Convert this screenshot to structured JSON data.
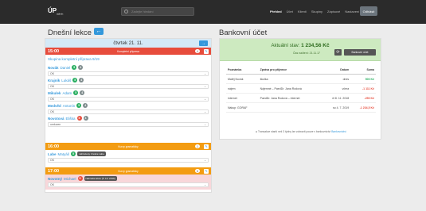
{
  "topbar": {
    "logo": "ÚP",
    "logo_sub": "admin",
    "search_placeholder": "Zadejte hledání",
    "nav": [
      "Přehled",
      "Účet",
      "Klienti",
      "Skupiny",
      "Zápisové",
      "Nastavení"
    ],
    "logout": "Odhlásit"
  },
  "left": {
    "title": "Dnešní lekce",
    "day": "čtvrtek 21. 11.",
    "lessons": [
      {
        "time": "15:00",
        "tag": "Kompletní příprava",
        "count": "4",
        "subject": "Skupina kompletní příprava 9/19",
        "students": [
          {
            "first": "Novák",
            "last": "Daniel",
            "b1": "5",
            "b2": "4",
            "select": "OK"
          },
          {
            "first": "Krajník",
            "last": "Lukáš",
            "b1": "5",
            "b2": "4",
            "select": "OK"
          },
          {
            "first": "Mikulek",
            "last": "Adam",
            "b1": "5",
            "b2": "4",
            "select": "OK"
          },
          {
            "first": "Medvěd",
            "last": "Antonín",
            "b1": "5",
            "b2": "4",
            "select": "OK"
          },
          {
            "first": "Novotová",
            "last": "Eliška",
            "b1": "5",
            "b2": "4",
            "select": "omluven"
          }
        ]
      },
      {
        "time": "16:00",
        "tag": "Kurzy gramaticky",
        "count": "1",
        "student": {
          "first": "Labe",
          "last": "Matyáš",
          "b1": "5",
          "pill": "nahrazeny 4 lekce Labe",
          "select": "OK"
        }
      },
      {
        "time": "17:00",
        "tag": "Kurzy gramaticky",
        "count": "6",
        "student": {
          "first": "Novotný",
          "last": "Michael",
          "b1": "5",
          "pill": "Náhrada lekce (5. 10. 2019)",
          "select": "OK"
        }
      }
    ]
  },
  "right": {
    "title": "Bankovní účet",
    "balance_label": "Aktuální stav:",
    "balance": "1 234,56 Kč",
    "updated": "Čas načtení: 21.11.17",
    "bank_button": "Bankovní účet",
    "headers": [
      "Poznámka",
      "Zpráva pro příjemce",
      "Datum",
      "Suma"
    ],
    "rows": [
      {
        "note": "Matěj Novák",
        "msg": "školka",
        "date": "dnes",
        "amount": "500 Kč",
        "type": "green"
      },
      {
        "note": "nájem",
        "msg": "Nájemné – PaedDr. Jana Rodová",
        "date": "včera",
        "amount": "-1 111 Kč",
        "type": "red"
      },
      {
        "note": "internet",
        "msg": "PaedDr. Jana Rodová – internet",
        "date": "čt 8. 11. 2018",
        "amount": "-250 Kč",
        "type": "red"
      },
      {
        "note": "Nákup: GORAF",
        "msg": "",
        "date": "so 4. 7. 2019",
        "amount": "-1 234,5 Kč",
        "type": "red"
      }
    ],
    "footnote": "Transakce starší než 3 týdny lze zobrazit pouze v bankovnictví",
    "footnote_link": "Bankovnictví"
  },
  "colors": {
    "accent": "#3498db",
    "red": "#e74c3c",
    "orange": "#f39c12",
    "green": "#27ae60",
    "topbar": "#2b2b2b"
  }
}
